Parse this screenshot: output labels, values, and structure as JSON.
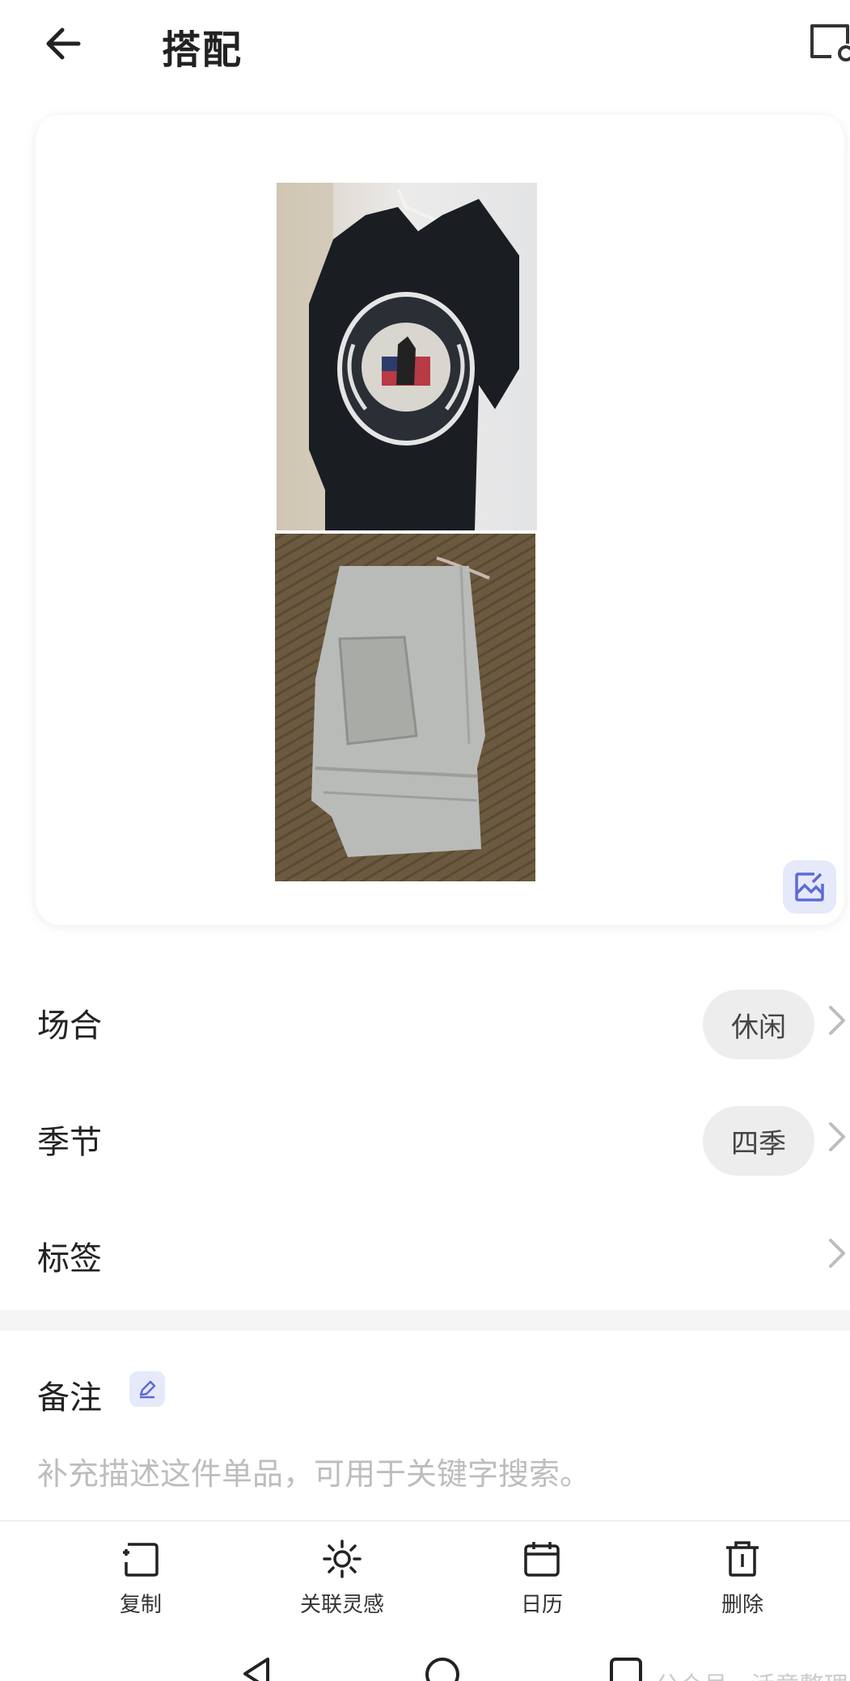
{
  "header": {
    "title": "搭配"
  },
  "rows": [
    {
      "label": "场合",
      "value": "休闲"
    },
    {
      "label": "季节",
      "value": "四季"
    },
    {
      "label": "标签",
      "value": ""
    }
  ],
  "note": {
    "label": "备注",
    "placeholder": "补充描述这件单品，可用于关键字搜索。"
  },
  "toolbar": {
    "items": [
      {
        "label": "复制",
        "icon": "copy-icon"
      },
      {
        "label": "关联灵感",
        "icon": "sun-icon"
      },
      {
        "label": "日历",
        "icon": "calendar-icon"
      },
      {
        "label": "删除",
        "icon": "trash-icon"
      }
    ]
  },
  "watermark": "公众号 · 活意整理"
}
